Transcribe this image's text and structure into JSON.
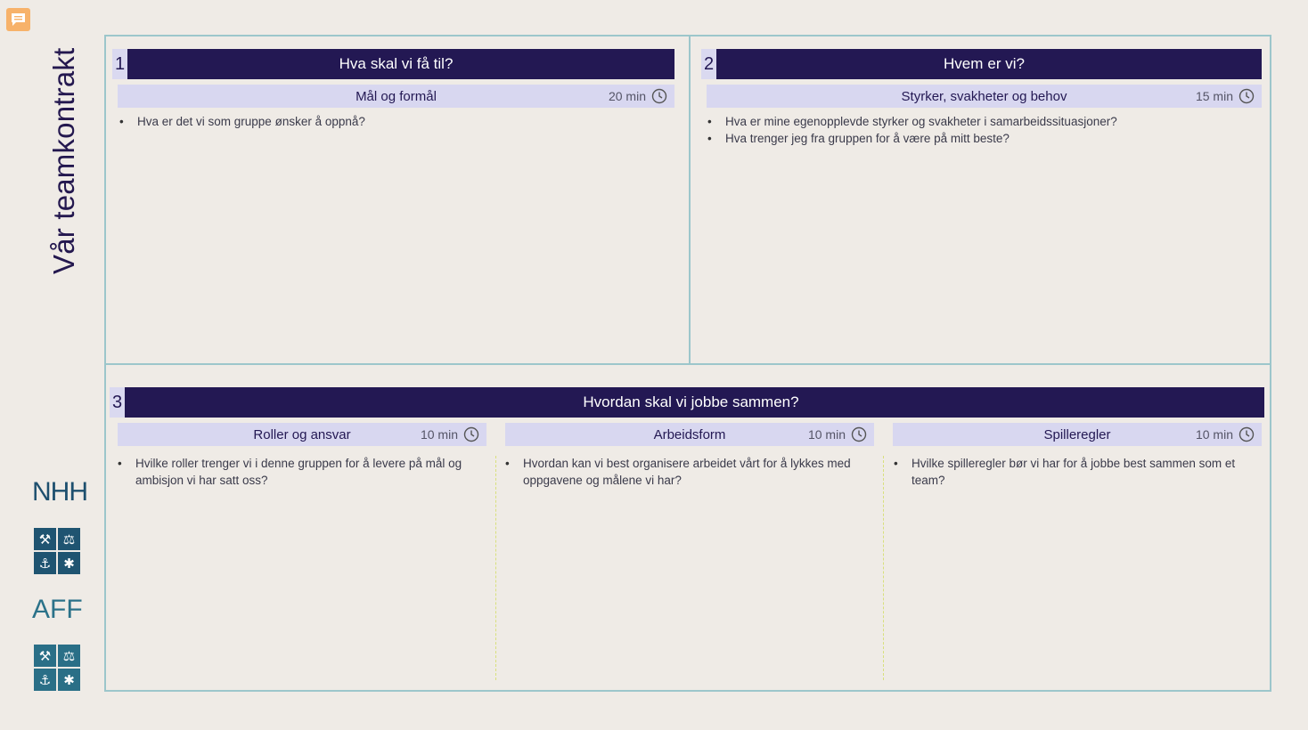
{
  "title": "Vår teamkontrakt",
  "logos": {
    "nhh": "NHH",
    "aff": "AFF",
    "emblem_icons": [
      "hammer-pick-icon",
      "scales-icon",
      "anchor-icon",
      "crab-icon"
    ]
  },
  "sections": [
    {
      "number": "1",
      "heading_bold": "Hva",
      "heading_rest": "skal vi få til?",
      "sub": [
        {
          "label": "Mål og formål",
          "time": "20 min",
          "bullets": [
            "Hva er det vi som gruppe ønsker å oppnå?"
          ]
        }
      ]
    },
    {
      "number": "2",
      "heading_bold": "Hvem",
      "heading_rest": "er vi?",
      "sub": [
        {
          "label": "Styrker, svakheter og behov",
          "time": "15 min",
          "bullets": [
            "Hva er mine egenopplevde styrker og svakheter i samarbeidssituasjoner?",
            "Hva trenger jeg fra gruppen for å være på mitt beste?"
          ]
        }
      ]
    },
    {
      "number": "3",
      "heading_bold": "Hvordan",
      "heading_rest": "skal vi jobbe sammen?",
      "sub": [
        {
          "label": "Roller og ansvar",
          "time": "10 min",
          "bullets": [
            "Hvilke roller trenger vi i denne gruppen for å levere på mål og ambisjon vi har satt oss?"
          ]
        },
        {
          "label": "Arbeidsform",
          "time": "10 min",
          "bullets": [
            "Hvordan kan vi best organisere arbeidet vårt for å lykkes med oppgavene og målene vi har?"
          ]
        },
        {
          "label": "Spilleregler",
          "time": "10 min",
          "bullets": [
            "Hvilke spilleregler bør vi har for å jobbe best sammen som et team?"
          ]
        }
      ]
    }
  ],
  "colors": {
    "background": "#efebe6",
    "header": "#231853",
    "subheader": "#d8d7f0",
    "border": "#9cc6cb",
    "comment": "#f7b26a"
  }
}
